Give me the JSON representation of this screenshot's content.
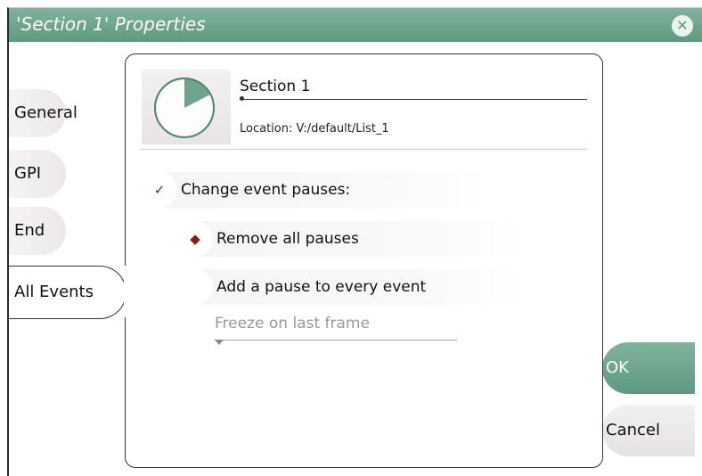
{
  "window": {
    "title": "'Section 1' Properties",
    "close_icon": "close-icon"
  },
  "tabs": [
    {
      "label": "General"
    },
    {
      "label": "GPI"
    },
    {
      "label": "End"
    },
    {
      "label": "All Events",
      "active": true
    }
  ],
  "header": {
    "icon": "pie-clock-icon",
    "section_name": "Section 1",
    "location": "Location: V:/default/List_1"
  },
  "options": {
    "change_event_pauses": {
      "label": "Change event pauses:",
      "checked": true
    },
    "remove_all_pauses": {
      "label": "Remove all pauses",
      "selected": true
    },
    "add_pause": {
      "label": "Add a pause to every event",
      "selected": false
    },
    "freeze_dropdown": {
      "value": "Freeze on last frame",
      "enabled": false
    }
  },
  "buttons": {
    "ok": "OK",
    "cancel": "Cancel"
  },
  "colors": {
    "accent": "#5e9a80",
    "check": "#8b1a1a"
  }
}
